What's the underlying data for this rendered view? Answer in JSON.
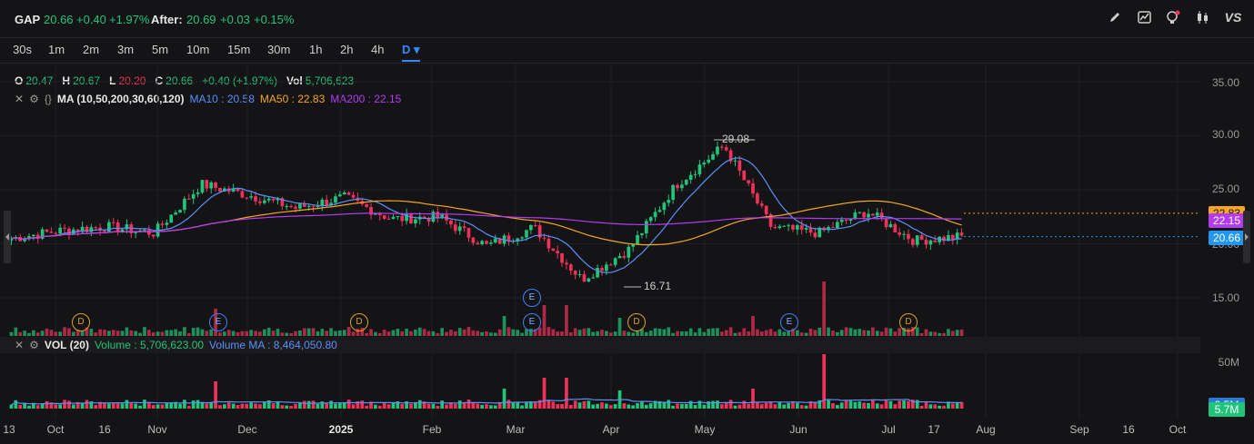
{
  "header": {
    "ticker": "GAP",
    "price": "20.66",
    "change": "+0.40",
    "change_pct": "+1.97%",
    "after_label": "After:",
    "after_price": "20.69",
    "after_change": "+0.03",
    "after_change_pct": "+0.15%",
    "toolbar_icons": [
      "pencil-icon",
      "chart-compare-icon",
      "lightbulb-icon",
      "candlestick-icon",
      "vs-icon"
    ],
    "vs_label": "VS"
  },
  "intervals": [
    "30s",
    "1m",
    "2m",
    "3m",
    "5m",
    "10m",
    "15m",
    "30m",
    "1h",
    "2h",
    "4h",
    "D"
  ],
  "active_interval": "D",
  "ohlc": {
    "o_label": "O",
    "o": "20.47",
    "h_label": "H",
    "h": "20.67",
    "l_label": "L",
    "l": "20.20",
    "c_label": "C",
    "c": "20.66",
    "chg": "+0.40 (+1.97%)",
    "vol_label": "Vol",
    "vol": "5,706,623"
  },
  "ma_indicator": {
    "name": "MA (10,50,200,30,60,120)",
    "ma10": "MA10 : 20.58",
    "ma50": "MA50 : 22.83",
    "ma200": "MA200 : 22.15"
  },
  "vol_indicator": {
    "name": "VOL (20)",
    "volume": "Volume : 5,706,623.00",
    "volume_ma": "Volume MA : 8,464,050.80"
  },
  "price_axis": [
    "35.00",
    "30.00",
    "25.00",
    "20.00",
    "15.00"
  ],
  "volume_axis": [
    "50M"
  ],
  "price_tags": {
    "ma50": "22.83",
    "ma200": "22.15",
    "last": "20.66",
    "volume": "5.7M",
    "ma_vol": "8.5M"
  },
  "annotations": {
    "high": "29.08",
    "low": "16.71"
  },
  "x_labels": [
    "13",
    "Oct",
    "16",
    "Nov",
    "Dec",
    "2025",
    "Feb",
    "Mar",
    "Apr",
    "May",
    "Jun",
    "Jul",
    "17",
    "Aug",
    "Sep",
    "16",
    "Oct"
  ],
  "colors": {
    "up": "#21c47b",
    "down": "#f0325a",
    "ma10": "#5b8ff9",
    "ma50": "#f5a623",
    "ma200": "#b53bf0",
    "accent": "#2f8cff"
  },
  "chart_data": {
    "type": "candlestick",
    "series": [
      {
        "name": "MA10",
        "last": 20.58
      },
      {
        "name": "MA50",
        "last": 22.83
      },
      {
        "name": "MA200",
        "last": 22.15
      }
    ],
    "points": [
      {
        "date": "Sep 20",
        "close": 20.5
      },
      {
        "date": "Oct 1",
        "close": 21.2
      },
      {
        "date": "Oct 16",
        "close": 21.6
      },
      {
        "date": "Nov 1",
        "close": 21.0
      },
      {
        "date": "Nov 22",
        "close": 25.5
      },
      {
        "date": "Dec 15",
        "close": 24.5
      },
      {
        "date": "2025 Jan 1",
        "close": 23.3
      },
      {
        "date": "Jan 20",
        "close": 24.3
      },
      {
        "date": "Feb 10",
        "close": 22.3
      },
      {
        "date": "Mar 1",
        "close": 22.5
      },
      {
        "date": "Mar 15",
        "close": 19.8
      },
      {
        "date": "Apr 1",
        "close": 21.5
      },
      {
        "date": "Apr 8",
        "close": 16.71
      },
      {
        "date": "Apr 25",
        "close": 19.5
      },
      {
        "date": "May 15",
        "close": 25.5
      },
      {
        "date": "May 28",
        "close": 29.08
      },
      {
        "date": "Jun 1",
        "close": 21.5
      },
      {
        "date": "Jun 20",
        "close": 21.0
      },
      {
        "date": "Jul 10",
        "close": 23.0
      },
      {
        "date": "Jul 17",
        "close": 20.3
      },
      {
        "date": "Jul 24",
        "close": 20.66
      }
    ],
    "ylim": [
      14,
      36
    ],
    "grid": true
  }
}
